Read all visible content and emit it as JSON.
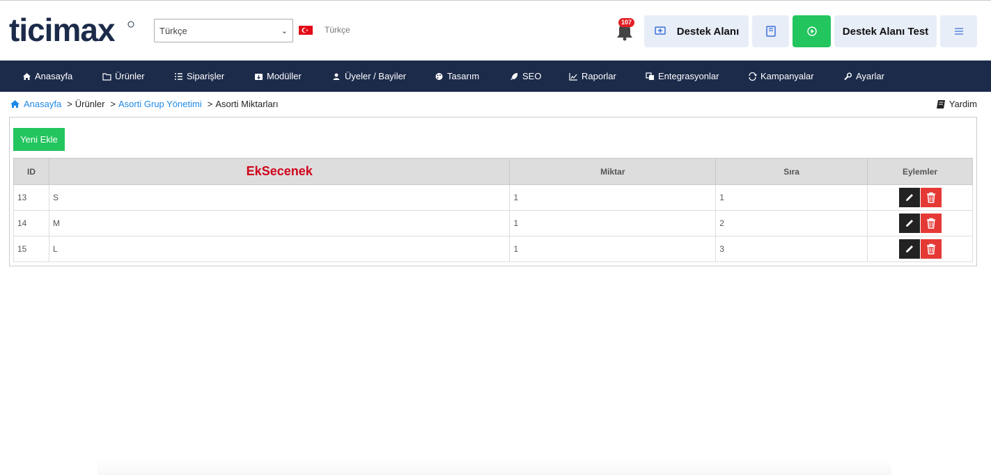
{
  "header": {
    "logo_text": "ticimax",
    "language_select_value": "Türkçe",
    "language_label": "Türkçe",
    "notification_count": "107",
    "support_button_label": "Destek Alanı",
    "store_button_label": "Destek Alanı Test"
  },
  "nav": [
    {
      "label": "Anasayfa",
      "icon": "home-icon"
    },
    {
      "label": "Ürünler",
      "icon": "folder-icon"
    },
    {
      "label": "Siparişler",
      "icon": "list-icon"
    },
    {
      "label": "Modüller",
      "icon": "module-icon"
    },
    {
      "label": "Üyeler / Bayiler",
      "icon": "users-icon"
    },
    {
      "label": "Tasarım",
      "icon": "palette-icon"
    },
    {
      "label": "SEO",
      "icon": "rocket-icon"
    },
    {
      "label": "Raporlar",
      "icon": "chart-icon"
    },
    {
      "label": "Entegrasyonlar",
      "icon": "copy-icon"
    },
    {
      "label": "Kampanyalar",
      "icon": "refresh-icon"
    },
    {
      "label": "Ayarlar",
      "icon": "wrench-icon"
    }
  ],
  "breadcrumb": {
    "home": "Anasayfa",
    "products": "Ürünler",
    "group": "Asorti Grup Yönetimi",
    "current": "Asorti Miktarları",
    "separator": ">"
  },
  "help_label": "Yardim",
  "add_button_label": "Yeni Ekle",
  "table": {
    "headers": [
      "ID",
      "EkSecenek",
      "Miktar",
      "Sıra",
      "Eylemler"
    ],
    "rows": [
      {
        "id": "13",
        "option": "S",
        "quantity": "1",
        "order": "1"
      },
      {
        "id": "14",
        "option": "M",
        "quantity": "1",
        "order": "2"
      },
      {
        "id": "15",
        "option": "L",
        "quantity": "1",
        "order": "3"
      }
    ]
  },
  "colors": {
    "navbar": "#1c2b4a",
    "green": "#22c55e",
    "accent_link": "#1e88e5",
    "header_red": "#d0021b",
    "delete_red": "#e53935"
  }
}
